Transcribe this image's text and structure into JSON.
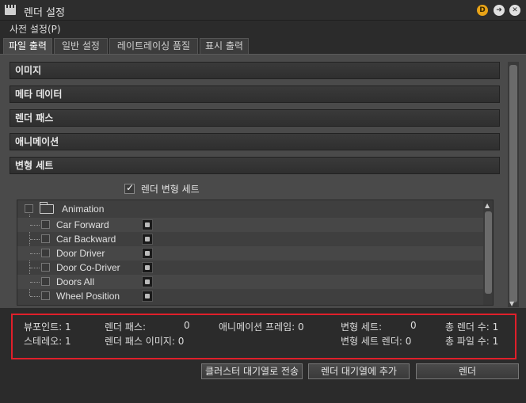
{
  "window": {
    "title": "렌더 설정",
    "brand_badge": "D"
  },
  "menu": {
    "presets": "사전 설정(P)"
  },
  "tabs": [
    {
      "label": "파일 출력",
      "active": true
    },
    {
      "label": "일반 설정",
      "active": false
    },
    {
      "label": "레이트레이싱 품질",
      "active": false
    },
    {
      "label": "표시 출력",
      "active": false
    }
  ],
  "rollouts": [
    "이미지",
    "메타 데이터",
    "렌더 패스",
    "애니메이션",
    "변형 세트"
  ],
  "variant_sets": {
    "render_checkbox_label": "렌더 변형 세트",
    "render_checked": true,
    "group": "Animation",
    "items": [
      "Car Forward",
      "Car Backward",
      "Door Driver",
      "Door Co-Driver",
      "Doors All",
      "Wheel Position"
    ]
  },
  "stats": {
    "viewports": "뷰포인트: 1",
    "stereo": "스테레오: 1",
    "render_passes_label": "렌더 패스:",
    "render_passes_value": "0",
    "render_pass_images": "렌더 패스 이미지: 0",
    "animation_frames": "애니메이션 프레임: 0",
    "variant_sets_label": "변형 세트:",
    "variant_sets_value": "0",
    "variant_set_renders": "변형 세트 렌더: 0",
    "total_renders": "총 렌더 수: 1",
    "total_files": "총 파일 수: 1"
  },
  "buttons": {
    "cluster_queue": "클러스터 대기열로 전송",
    "add_to_queue": "렌더 대기열에 추가",
    "render": "렌더"
  },
  "colors": {
    "highlight_border": "#e01f2a",
    "badge_orange": "#e8a317"
  }
}
